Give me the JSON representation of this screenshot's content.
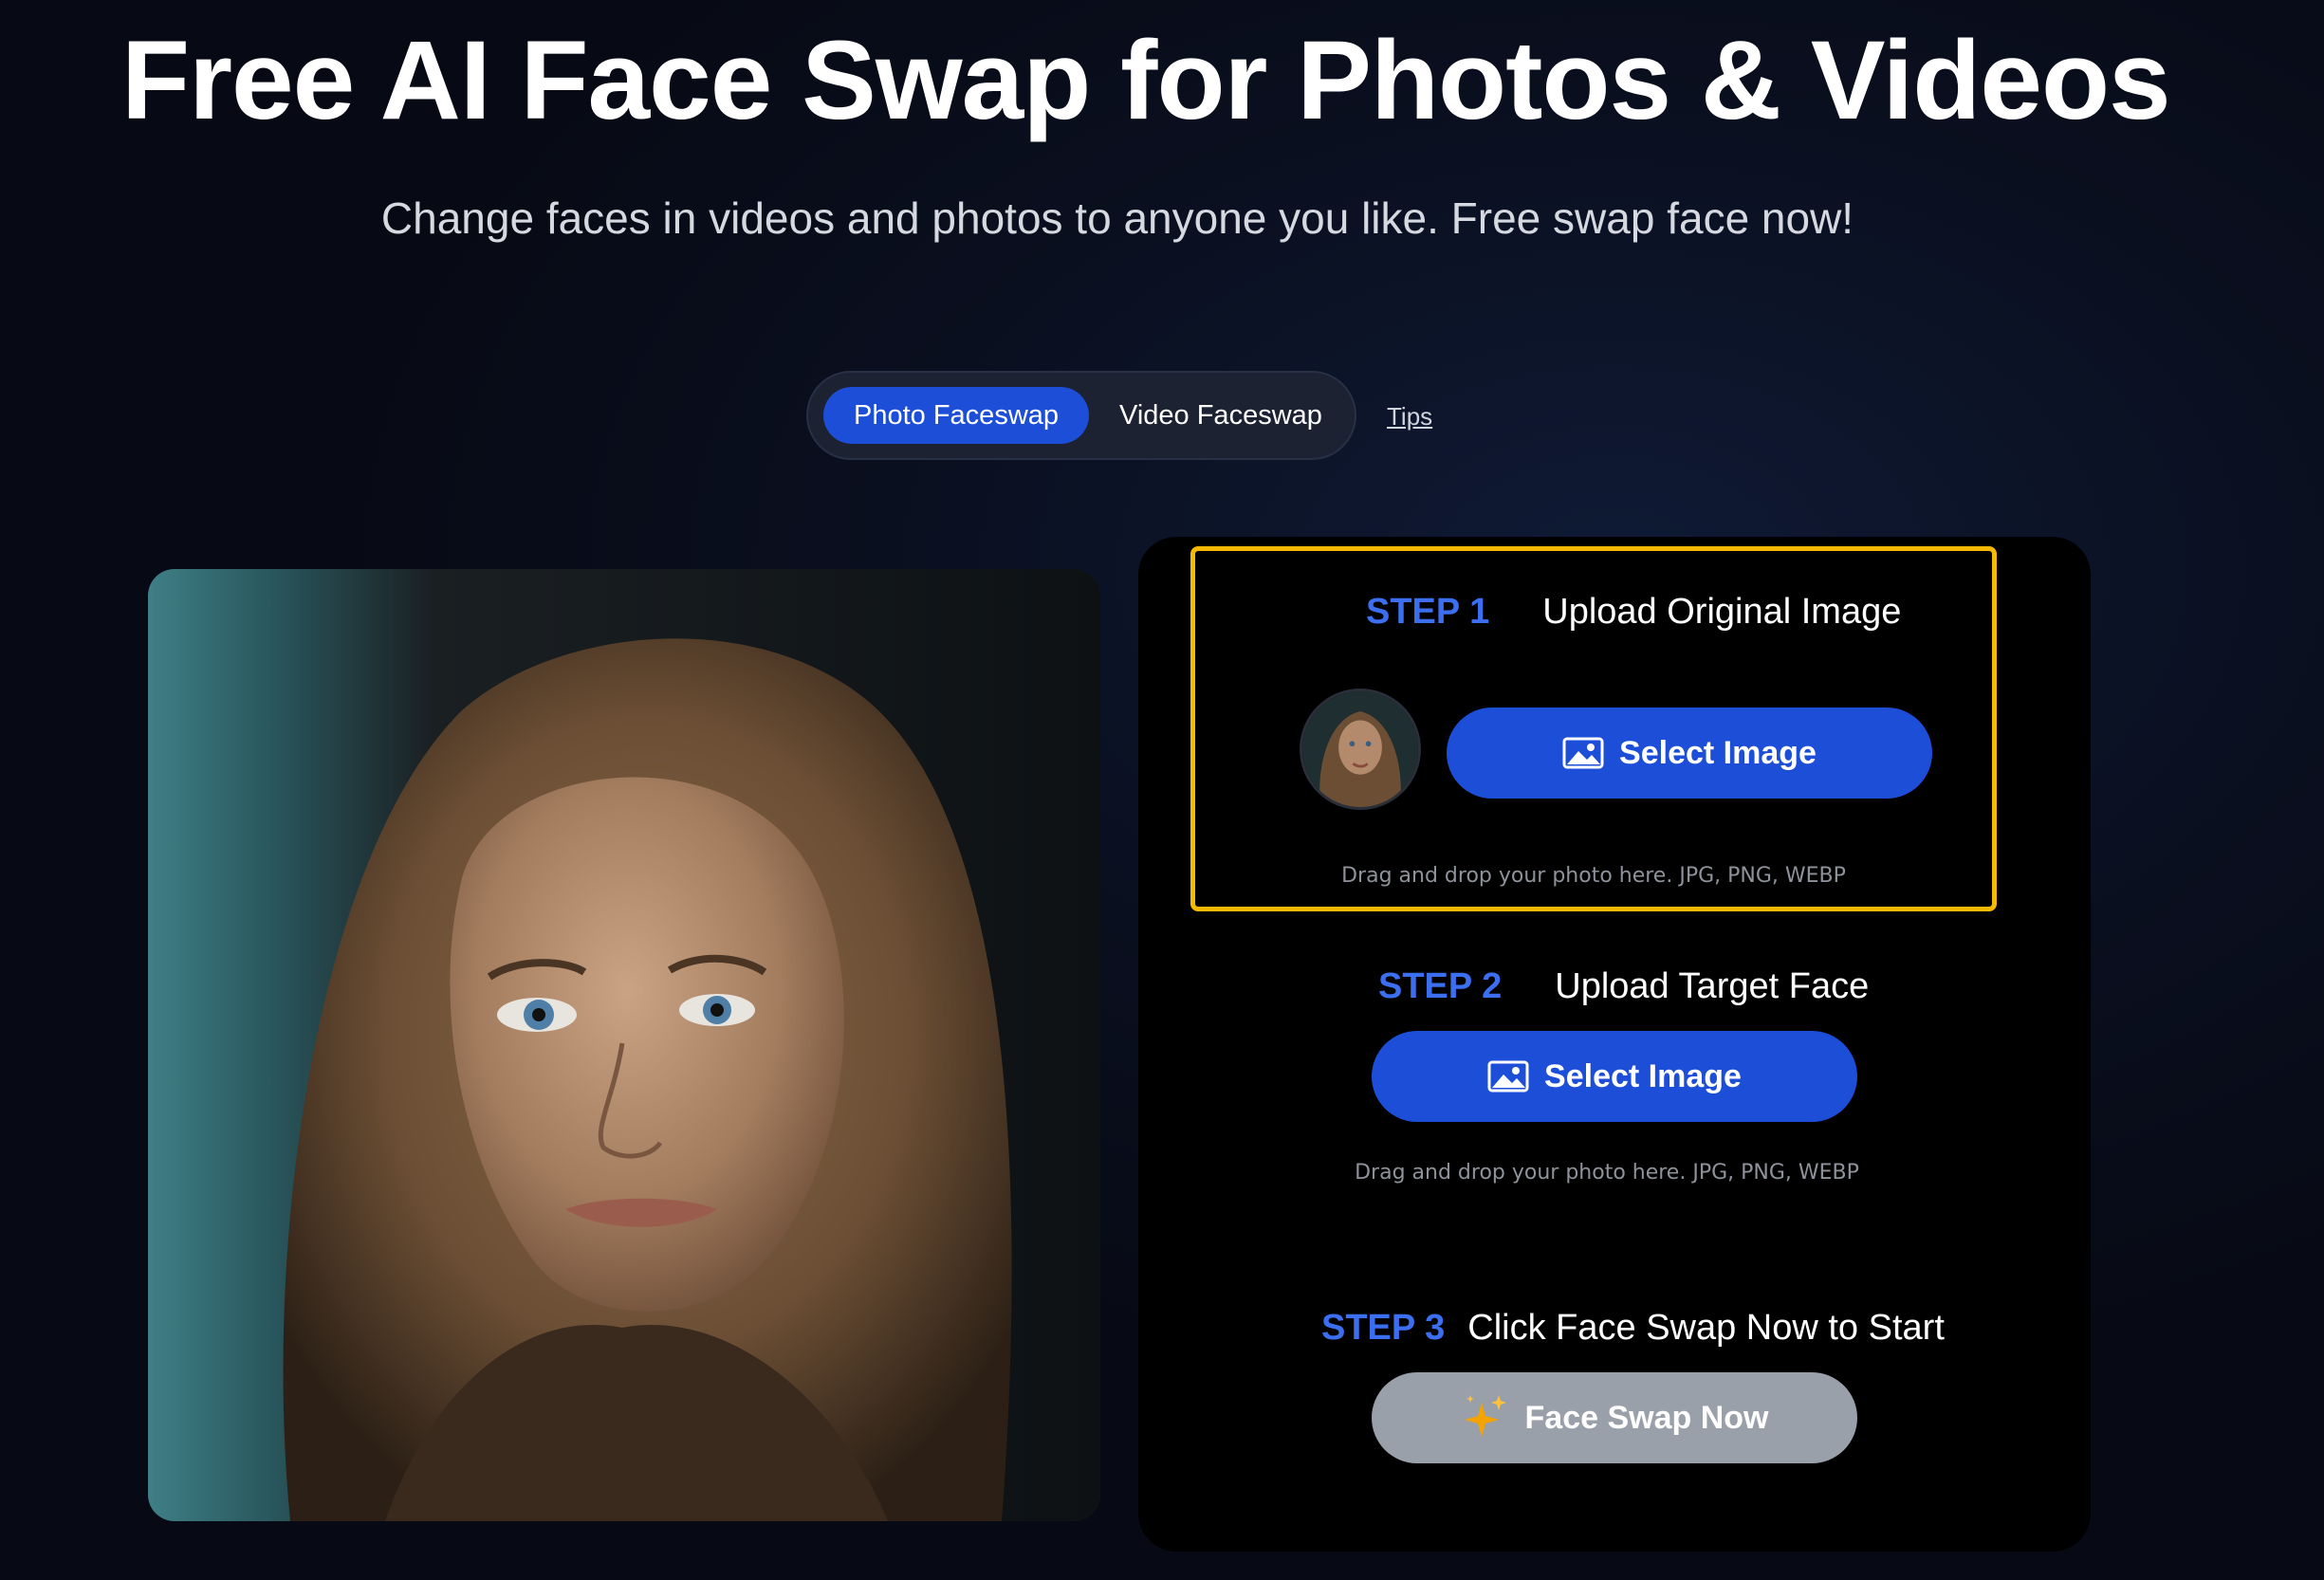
{
  "hero": {
    "title": "Free AI Face Swap for Photos & Videos",
    "subtitle": "Change faces in videos and photos to anyone you like. Free swap face now!"
  },
  "mode_switch": {
    "tabs": [
      {
        "label": "Photo Faceswap",
        "active": true
      },
      {
        "label": "Video Faceswap",
        "active": false
      }
    ],
    "tips_label": "Tips"
  },
  "steps": {
    "step1": {
      "number": "STEP 1",
      "title": "Upload Original Image",
      "button_label": "Select Image",
      "hint": "Drag and drop your photo here. JPG, PNG, WEBP"
    },
    "step2": {
      "number": "STEP 2",
      "title": "Upload Target Face",
      "button_label": "Select Image",
      "hint": "Drag and drop your photo here. JPG, PNG, WEBP"
    },
    "step3": {
      "number": "STEP 3",
      "title": "Click Face Swap Now to Start",
      "button_label": "Face Swap Now"
    }
  },
  "colors": {
    "accent_blue": "#1d4ed8",
    "step_number_blue": "#3b6ff0",
    "highlight_border": "#f5b900",
    "disabled_button": "#9aa0aa",
    "panel_bg": "#000000",
    "page_bg": "#0a0f1f"
  },
  "icons": {
    "image_icon": "image-icon",
    "sparkle_icon": "sparkle-icon"
  }
}
